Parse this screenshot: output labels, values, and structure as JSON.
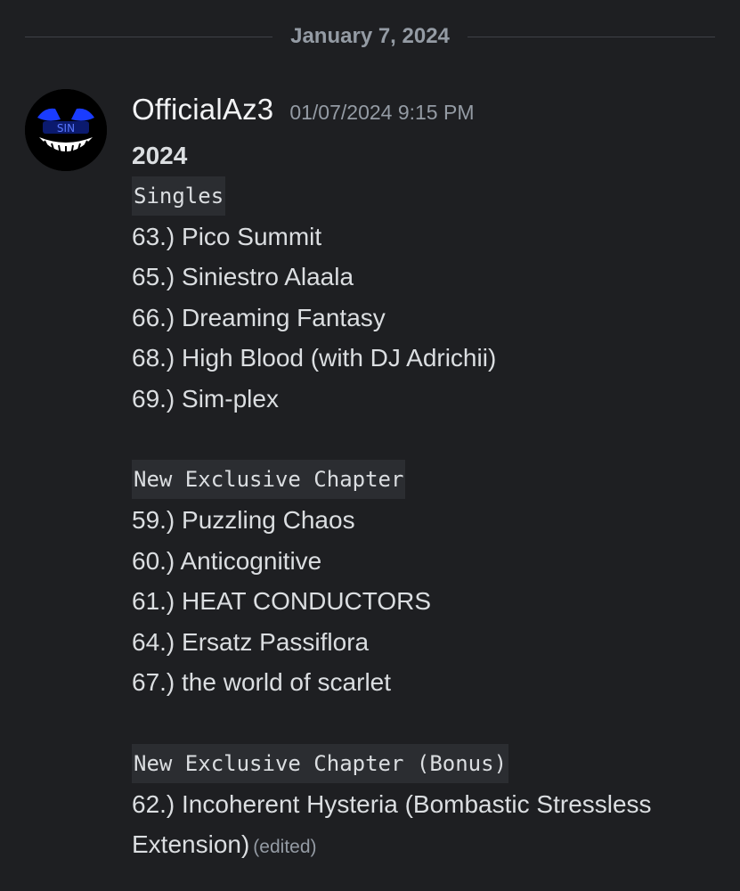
{
  "divider": {
    "date": "January 7, 2024"
  },
  "message": {
    "username": "OfficialAz3",
    "timestamp": "01/07/2024 9:15 PM",
    "heading": "2024",
    "sections": [
      {
        "label": "Singles",
        "tracks": [
          "63.) Pico Summit",
          "65.) Siniestro Alaala",
          "66.) Dreaming Fantasy",
          "68.) High Blood (with DJ Adrichii)",
          "69.) Sim-plex"
        ]
      },
      {
        "label": "New Exclusive Chapter",
        "tracks": [
          "59.) Puzzling Chaos",
          "60.) Anticognitive",
          "61.) HEAT CONDUCTORS",
          "64.) Ersatz Passiflora",
          "67.) the world of scarlet"
        ]
      },
      {
        "label": "New Exclusive Chapter (Bonus)",
        "tracks": [
          "62.) Incoherent Hysteria (Bombastic Stressless Extension)"
        ]
      }
    ],
    "edited_label": "(edited)"
  },
  "avatar": {
    "icon": "grinning-face-logo-icon",
    "text": "SIN",
    "accent": "#1a3cff"
  },
  "colors": {
    "background": "#1e1f22",
    "code_background": "#2b2d31",
    "muted": "#949ba4",
    "text": "#dbdee1"
  }
}
